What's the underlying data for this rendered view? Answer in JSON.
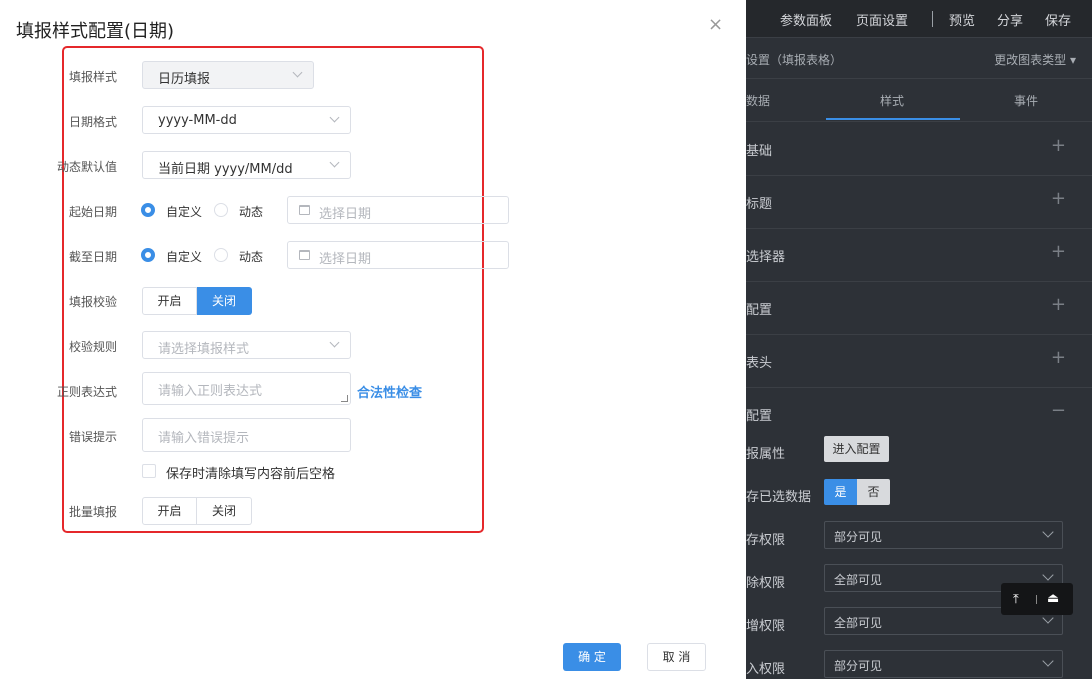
{
  "right_panel": {
    "topbar": {
      "param_panel": "参数面板",
      "page_settings": "页面设置",
      "preview": "预览",
      "share": "分享",
      "save": "保存"
    },
    "sub_header": {
      "title": "设置（填报表格）",
      "change_type": "更改图表类型 ▾"
    },
    "tabs": [
      "数据",
      "样式",
      "事件"
    ],
    "active_tab": "样式",
    "sections": [
      "基础",
      "标题",
      "选择器",
      "配置",
      "表头",
      "配置"
    ],
    "props": {
      "fill_attr_label": "报属性",
      "enter_config": "进入配置",
      "save_selected_label": "存已选数据",
      "yes": "是",
      "no": "否",
      "save_perm_label": "存权限",
      "save_perm_value": "部分可见",
      "delete_perm_label": "除权限",
      "delete_perm_value": "全部可见",
      "add_perm_label": "增权限",
      "add_perm_value": "全部可见",
      "import_perm_label": "入权限",
      "import_perm_value": "部分可见"
    },
    "float_tool": {
      "top_icon": "⤒",
      "eject_icon": "⏏"
    },
    "colors": {
      "panel_bg": "#2d3137",
      "topbar_bg": "#25282c",
      "accent": "#3a8ee6"
    }
  },
  "dialog": {
    "title": "填报样式配置(日期)",
    "close_glyph": "×",
    "fields": {
      "fill_style": {
        "label": "填报样式",
        "value": "日历填报"
      },
      "date_format": {
        "label": "日期格式",
        "value": "yyyy-MM-dd"
      },
      "dynamic_default": {
        "label": "动态默认值",
        "value": "当前日期 yyyy/MM/dd"
      },
      "start_date": {
        "label": "起始日期",
        "custom": "自定义",
        "dynamic": "动态",
        "selected": "自定义",
        "placeholder": "选择日期"
      },
      "end_date": {
        "label": "截至日期",
        "custom": "自定义",
        "dynamic": "动态",
        "selected": "自定义",
        "placeholder": "选择日期"
      },
      "validation": {
        "label": "填报校验",
        "on": "开启",
        "off": "关闭",
        "selected": "关闭"
      },
      "rule": {
        "label": "校验规则",
        "placeholder": "请选择填报样式"
      },
      "regex": {
        "label": "正则表达式",
        "placeholder": "请输入正则表达式",
        "check": "合法性检查"
      },
      "error_tip": {
        "label": "错误提示",
        "placeholder": "请输入错误提示"
      },
      "trim_checkbox": {
        "label": "保存时清除填写内容前后空格",
        "checked": false
      },
      "batch_fill": {
        "label": "批量填报",
        "on": "开启",
        "off": "关闭",
        "selected": ""
      }
    },
    "buttons": {
      "ok": "确 定",
      "cancel": "取 消"
    },
    "colors": {
      "highlight_frame": "#e5282b",
      "primary": "#3a8ee6"
    }
  }
}
